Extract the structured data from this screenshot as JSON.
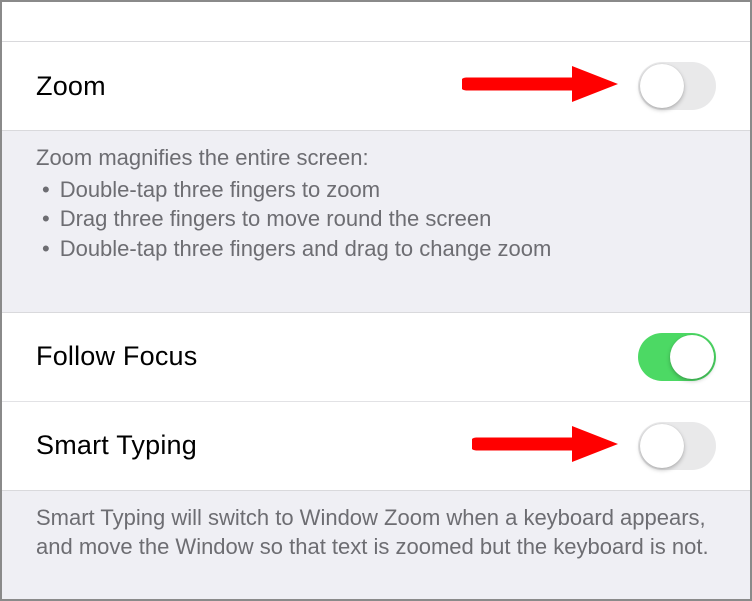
{
  "rows": {
    "zoom": {
      "label": "Zoom",
      "on": false
    },
    "followFocus": {
      "label": "Follow Focus",
      "on": true
    },
    "smartTyping": {
      "label": "Smart Typing",
      "on": false
    }
  },
  "zoomHelp": {
    "title": "Zoom magnifies the entire screen:",
    "items": [
      "Double-tap three fingers to zoom",
      "Drag three fingers to move round the screen",
      "Double-tap three fingers and drag to change zoom"
    ]
  },
  "smartTypingHelp": "Smart Typing will switch to Window Zoom when a keyboard appears, and move the Window so that text is zoomed but the keyboard is not."
}
